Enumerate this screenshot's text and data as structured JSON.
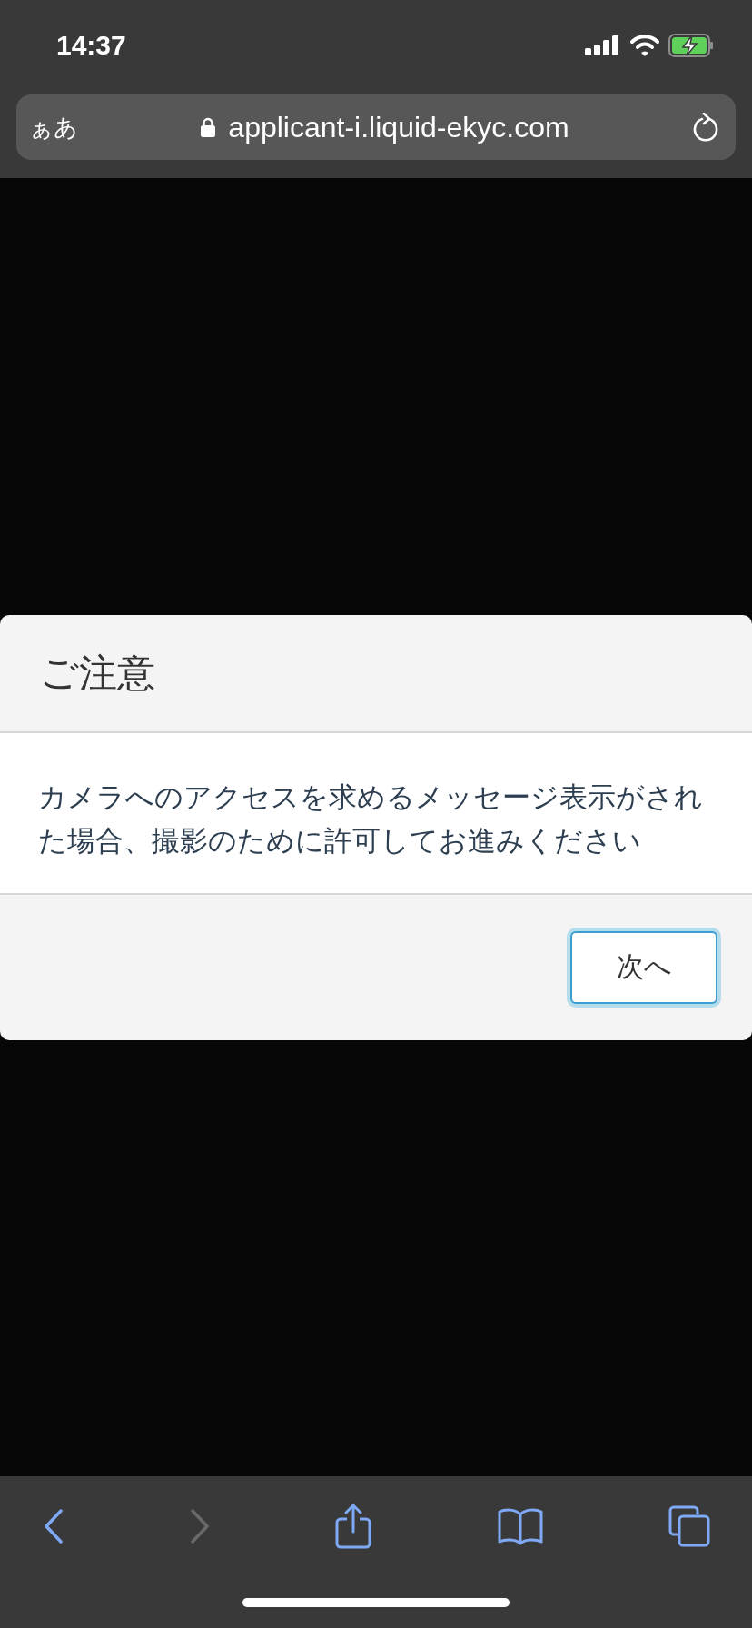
{
  "status_bar": {
    "time": "14:37",
    "charging": true
  },
  "address_bar": {
    "text_size_button": "ぁあ",
    "url": "applicant-i.liquid-ekyc.com",
    "secure": true
  },
  "dialog": {
    "title": "ご注意",
    "message": "カメラへのアクセスを求めるメッセージ表示がされた場合、撮影のために許可してお進みください",
    "buttons": [
      {
        "label": "次へ",
        "focused": true
      }
    ]
  },
  "toolbar": [
    {
      "kind": "back",
      "disabled": false
    },
    {
      "kind": "forward",
      "disabled": true
    },
    {
      "kind": "share",
      "disabled": false
    },
    {
      "kind": "bookmarks",
      "disabled": false
    },
    {
      "kind": "tabs",
      "disabled": false
    }
  ]
}
